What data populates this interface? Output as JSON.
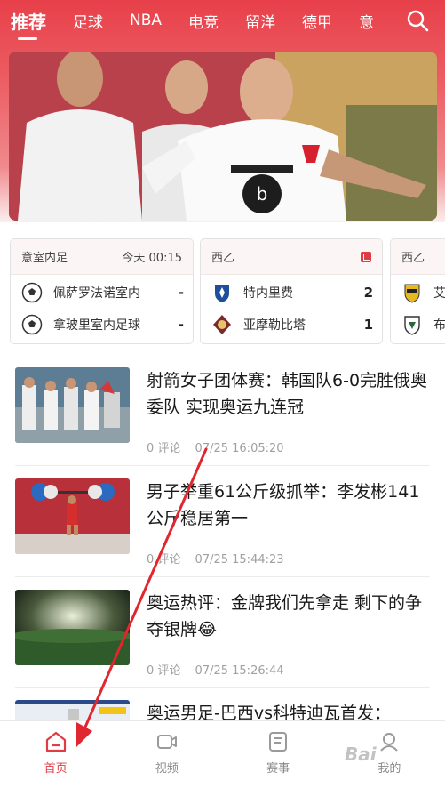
{
  "tabs": [
    "推荐",
    "足球",
    "NBA",
    "电竞",
    "留洋",
    "德甲",
    "意"
  ],
  "active_tab_index": 0,
  "colors": {
    "brand": "#e03c45",
    "header": "#e8404a"
  },
  "icons": {
    "search": "search-icon"
  },
  "scores": [
    {
      "league": "意室内足",
      "time": "今天 00:15",
      "live": false,
      "home": {
        "name": "佩萨罗法诺室内",
        "score": "-"
      },
      "away": {
        "name": "拿玻里室内足球",
        "score": "-"
      }
    },
    {
      "league": "西乙",
      "time": "",
      "live": true,
      "home": {
        "name": "特内里费",
        "score": "2"
      },
      "away": {
        "name": "亚摩勒比塔",
        "score": "1"
      }
    },
    {
      "league": "西乙",
      "time": "",
      "live": false,
      "home": {
        "name": "艾",
        "score": ""
      },
      "away": {
        "name": "布",
        "score": ""
      }
    }
  ],
  "news": [
    {
      "title": "射箭女子团体赛：韩国队6-0完胜俄奥委队 实现奥运九连冠",
      "comments": "0 评论",
      "time": "07/25 16:05:20"
    },
    {
      "title": "男子举重61公斤级抓举：李发彬141公斤稳居第一",
      "comments": "0 评论",
      "time": "07/25 15:44:23"
    },
    {
      "title": "奥运热评：金牌我们先拿走 剩下的争夺银牌😂",
      "comments": "0 评论",
      "time": "07/25 15:26:44"
    },
    {
      "title": "奥运男足-巴西vs科特迪瓦首发：",
      "comments": "",
      "time": ""
    }
  ],
  "bottom_nav": [
    {
      "label": "首页",
      "icon": "home-icon",
      "active": true
    },
    {
      "label": "视频",
      "icon": "video-icon",
      "active": false
    },
    {
      "label": "赛事",
      "icon": "match-icon",
      "active": false
    },
    {
      "label": "我的",
      "icon": "profile-icon",
      "active": false
    }
  ],
  "watermark": "Bai"
}
